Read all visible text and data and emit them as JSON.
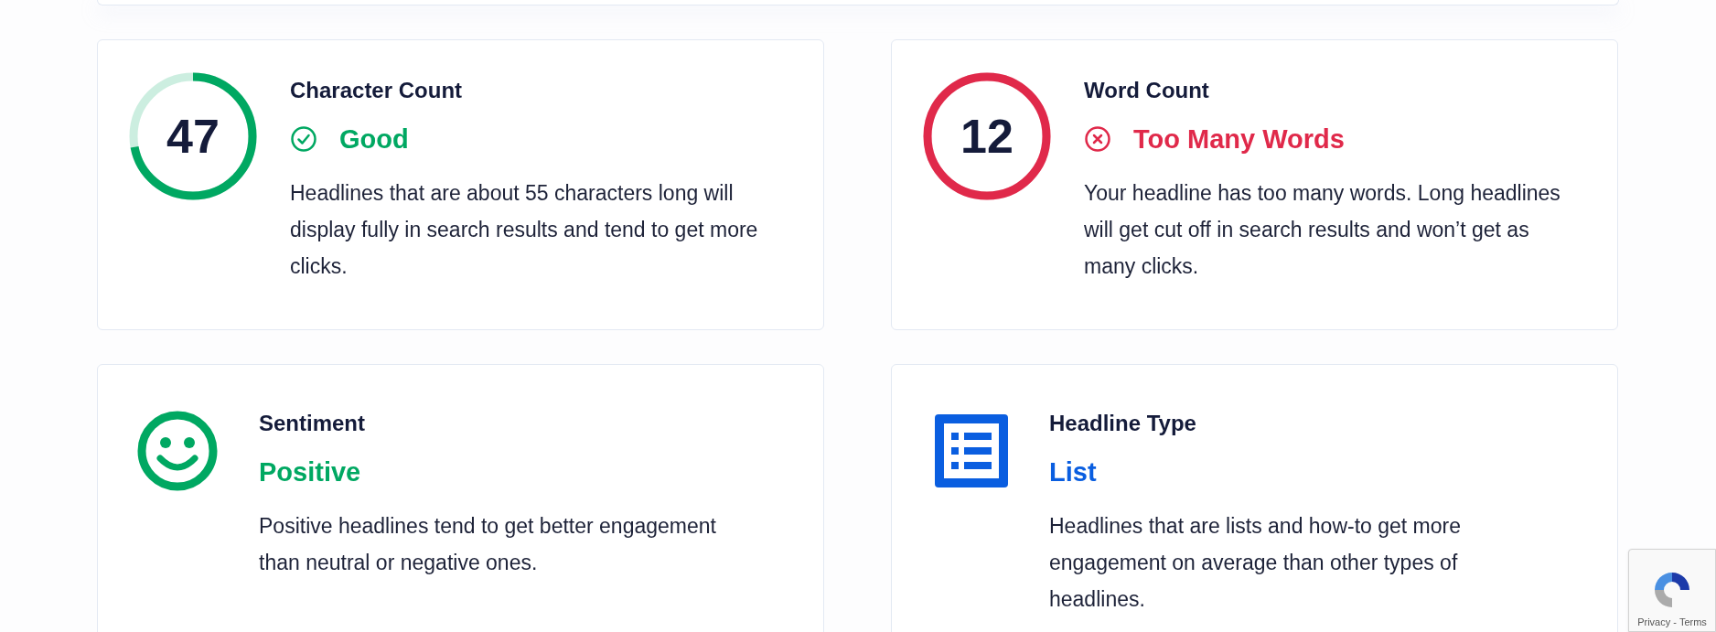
{
  "metrics": [
    {
      "kind": "gauge",
      "value": "47",
      "color": "#00a862",
      "title": "Character Count",
      "status": {
        "kind": "good",
        "label": "Good"
      },
      "description": "Headlines that are about 55 characters long will display fully in search results and tend to get more clicks."
    },
    {
      "kind": "gauge",
      "value": "12",
      "color": "#e0294a",
      "title": "Word Count",
      "status": {
        "kind": "bad",
        "label": "Too Many Words"
      },
      "description": "Your headline has too many words. Long headlines will get cut off in search results and won’t get as many clicks."
    },
    {
      "kind": "sentiment",
      "color": "#00a862",
      "title": "Sentiment",
      "status": {
        "kind": "none",
        "label": "Positive"
      },
      "description": "Positive headlines tend to get better engagement than neutral or negative ones."
    },
    {
      "kind": "type",
      "color": "#0a5ee0",
      "title": "Headline Type",
      "status": {
        "kind": "none",
        "label": "List"
      },
      "description": "Headlines that are lists and how-to get more engagement on average than other types of headlines."
    }
  ],
  "recaptcha": {
    "links": [
      "Privacy",
      "Terms"
    ],
    "separator": "-"
  }
}
